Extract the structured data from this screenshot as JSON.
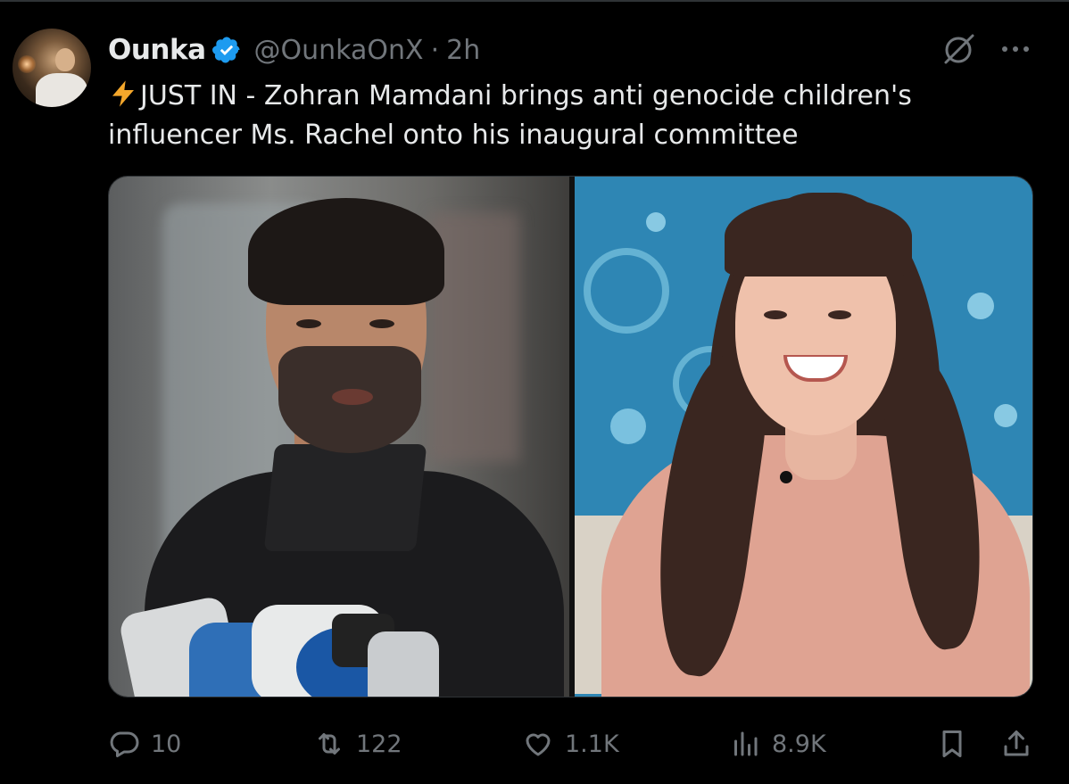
{
  "author": {
    "display_name": "Ounka",
    "handle": "@OunkaOnX",
    "separator": "·",
    "time": "2h",
    "verified": true,
    "verified_color": "#1d9bf0"
  },
  "tweet": {
    "text_lines": [
      "JUST IN - Zohran Mamdani brings anti genocide children's",
      "influencer Ms. Rachel onto his inaugural committee"
    ],
    "emoji_icon": "lightning-bolt-icon"
  },
  "media": {
    "count": 2
  },
  "actions": {
    "replies": "10",
    "retweets": "122",
    "likes": "1.1K",
    "views": "8.9K"
  },
  "icons": {
    "reply": "reply-icon",
    "retweet": "retweet-icon",
    "like": "heart-icon",
    "views": "views-chart-icon",
    "bookmark": "bookmark-icon",
    "share": "share-icon",
    "grok": "grok-icon",
    "more": "more-icon"
  },
  "colors": {
    "background": "#000000",
    "text": "#e7e9ea",
    "muted": "#71767b",
    "accent": "#1d9bf0",
    "bolt": "#f4a72b"
  }
}
